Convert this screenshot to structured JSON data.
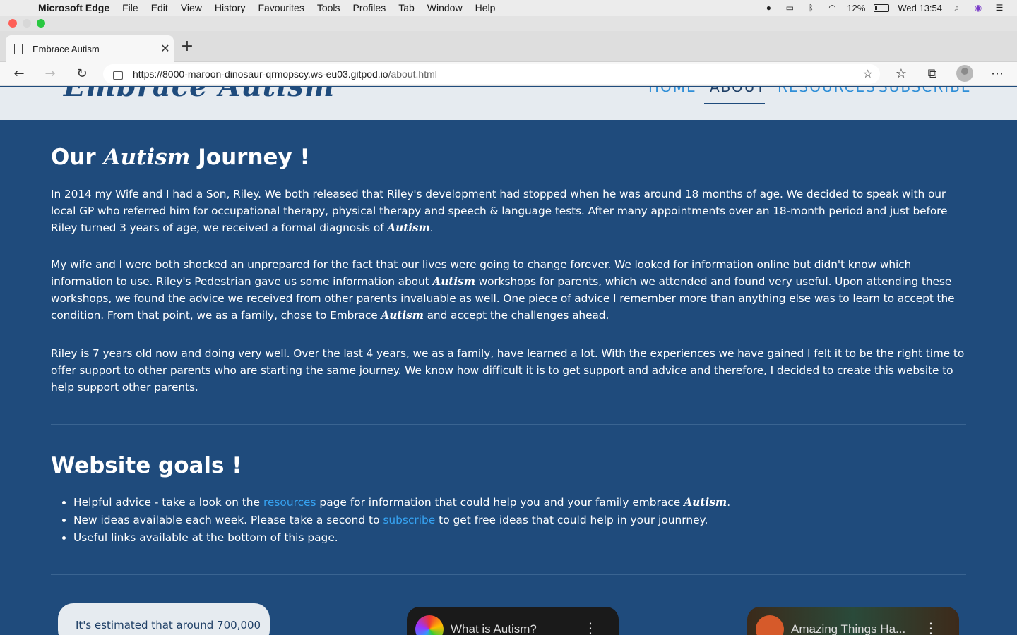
{
  "menubar": {
    "app_name": "Microsoft Edge",
    "items": [
      "File",
      "Edit",
      "View",
      "History",
      "Favourites",
      "Tools",
      "Profiles",
      "Tab",
      "Window",
      "Help"
    ],
    "battery": "12%",
    "clock": "Wed 13:54"
  },
  "browser": {
    "tab_title": "Embrace Autism",
    "url_main": "https://8000-maroon-dinosaur-qrmopscy.ws-eu03.gitpod.io",
    "url_path": "/about.html"
  },
  "site": {
    "logo": "Embrace Autism",
    "nav": [
      "HOME",
      "ABOUT",
      "RESOURCES",
      "SUBSCRIBE"
    ],
    "active_nav": "ABOUT"
  },
  "journey": {
    "title_pre": "Our ",
    "title_em": "Autism",
    "title_post": " Journey !",
    "p1_a": "In 2014 my Wife and I had a Son, Riley. We both released that Riley's development had stopped when he was around 18 months of age. We decided to speak with our local GP who referred him for occupational therapy, physical therapy and speech & language tests. After many appointments over an 18-month period and just before Riley turned 3 years of age, we received a formal diagnosis of ",
    "p1_em": "Autism",
    "p1_b": ".",
    "p2_a": "My wife and I were both shocked an unprepared for the fact that our lives were going to change forever. We looked for information online but didn't know which information to use. Riley's Pedestrian gave us some information about ",
    "p2_em": "Autism",
    "p2_b": " workshops for parents, which we attended and found very useful. Upon attending these workshops, we found the advice we received from other parents invaluable as well. One piece of advice I remember more than anything else was to learn to accept the condition. From that point, we as a family, chose to Embrace ",
    "p2_em2": "Autism",
    "p2_c": " and accept the challenges ahead.",
    "p3": "Riley is 7 years old now and doing very well. Over the last 4 years, we as a family, have learned a lot. With the experiences we have gained I felt it to be the right time to offer support to other parents who are starting the same journey. We know how difficult it is to get support and advice and therefore, I decided to create this website to help support other parents."
  },
  "goals": {
    "title": "Website goals !",
    "g1_a": "Helpful advice - take a look on the ",
    "g1_link": "resources",
    "g1_b": " page for information that could help you and your family embrace ",
    "g1_em": "Autism",
    "g1_c": ".",
    "g2_a": "New ideas available each week. Please take a second to ",
    "g2_link": "subscribe",
    "g2_b": " to get free ideas that could help in your jounrney.",
    "g3": "Useful links available at the bottom of this page."
  },
  "cards": {
    "quote": "It's estimated that around 700,000",
    "video1_title": "What is Autism?",
    "video2_title": "Amazing Things Ha..."
  },
  "colors": {
    "page_bg": "#1f4b7c",
    "header_bg": "#e6ebf0",
    "link": "#36a3f2",
    "nav_link": "#2f8fd8"
  }
}
